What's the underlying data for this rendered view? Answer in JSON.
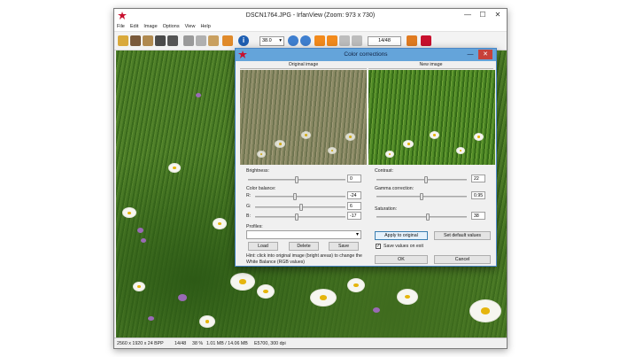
{
  "window": {
    "title": "DSCN1764.JPG - IrfanView (Zoom: 973 x 730)",
    "min_glyph": "—",
    "max_glyph": "☐",
    "close_glyph": "✕"
  },
  "menu": [
    "File",
    "Edit",
    "Image",
    "Options",
    "View",
    "Help"
  ],
  "toolbar": {
    "zoom_value": "38.0",
    "page_value": "14/48",
    "icons": [
      "open-icon",
      "slideshow-icon",
      "thumbnails-icon",
      "save-icon",
      "print-icon",
      "cut-icon",
      "copy-icon",
      "paste-icon",
      "undo-icon",
      "info-icon",
      "zoom-in-icon",
      "zoom-out-icon",
      "prev-icon",
      "next-icon",
      "first-icon",
      "last-icon",
      "settings-icon",
      "exit-icon"
    ]
  },
  "status": {
    "dims": "2560 x 1920 x 24 BPP",
    "index": "14/48",
    "zoom": "38 %",
    "size": "1.01 MB / 14.06 MB",
    "exif": "E5700, 300 dpi"
  },
  "dialog": {
    "title": "Color corrections",
    "close_glyph": "✕",
    "min_glyph": "—",
    "original_label": "Original image",
    "new_label": "New image",
    "brightness": {
      "label": "Brightness:",
      "value": "0",
      "level": 0.5
    },
    "color_balance_label": "Color balance:",
    "r": {
      "label": "R:",
      "value": "-24",
      "level": 0.44
    },
    "g": {
      "label": "G:",
      "value": "6",
      "level": 0.51
    },
    "b": {
      "label": "B:",
      "value": "-17",
      "level": 0.46
    },
    "profiles_label": "Profiles:",
    "contrast": {
      "label": "Contrast:",
      "value": "22",
      "level": 0.55
    },
    "gamma": {
      "label": "Gamma correction:",
      "value": "0.95",
      "level": 0.5
    },
    "saturation": {
      "label": "Saturation:",
      "value": "38",
      "level": 0.57
    },
    "buttons": {
      "load": "Load",
      "delete": "Delete",
      "save": "Save",
      "apply": "Apply to original",
      "defaults": "Set default values",
      "ok": "OK",
      "cancel": "Cancel"
    },
    "save_values_label": "Save values on exit",
    "save_values_checked": true,
    "hint": "Hint: click into original image (bright areas) to change the White Balance (RGB values)"
  }
}
